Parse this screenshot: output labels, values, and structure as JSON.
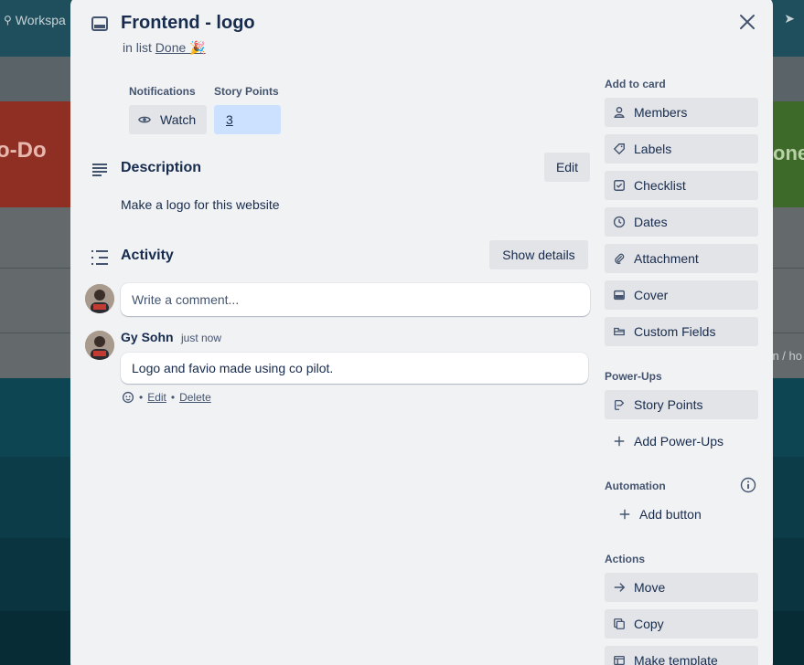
{
  "background": {
    "workspace_label": "Workspa",
    "left_list_title": "o-Do",
    "right_list_title": "one",
    "right_snippet": "n / ho"
  },
  "card": {
    "title": "Frontend - logo",
    "in_list_prefix": "in list",
    "list_name": "Done 🎉",
    "notifications_label": "Notifications",
    "watch_label": "Watch",
    "story_points_label": "Story Points",
    "story_points_value": "3"
  },
  "description": {
    "heading": "Description",
    "edit_label": "Edit",
    "text": "Make a logo for this website"
  },
  "activity": {
    "heading": "Activity",
    "show_details_label": "Show details",
    "comment_placeholder": "Write a comment...",
    "comments": [
      {
        "author": "Gy Sohn",
        "time": "just now",
        "text": "Logo and favio made using co pilot.",
        "edit_label": "Edit",
        "delete_label": "Delete",
        "separator": "•"
      }
    ]
  },
  "sidebar": {
    "add_to_card_label": "Add to card",
    "add_to_card": [
      {
        "label": "Members",
        "icon": "person-icon"
      },
      {
        "label": "Labels",
        "icon": "tag-icon"
      },
      {
        "label": "Checklist",
        "icon": "checkbox-icon"
      },
      {
        "label": "Dates",
        "icon": "clock-icon"
      },
      {
        "label": "Attachment",
        "icon": "paperclip-icon"
      },
      {
        "label": "Cover",
        "icon": "card-cover-icon"
      },
      {
        "label": "Custom Fields",
        "icon": "custom-fields-icon"
      }
    ],
    "powerups_label": "Power-Ups",
    "story_points_button": "Story Points",
    "add_powerups_button": "Add Power-Ups",
    "automation_label": "Automation",
    "add_button_label": "Add button",
    "actions_label": "Actions",
    "actions": [
      {
        "label": "Move",
        "icon": "arrow-right-icon"
      },
      {
        "label": "Copy",
        "icon": "copy-icon"
      },
      {
        "label": "Make template",
        "icon": "template-icon"
      }
    ]
  },
  "colors": {
    "modal_bg": "#f1f2f4",
    "button_bg": "#e2e4e8",
    "story_points_bg": "#cce0ff",
    "text_primary": "#172b4d",
    "text_secondary": "#44546f"
  }
}
